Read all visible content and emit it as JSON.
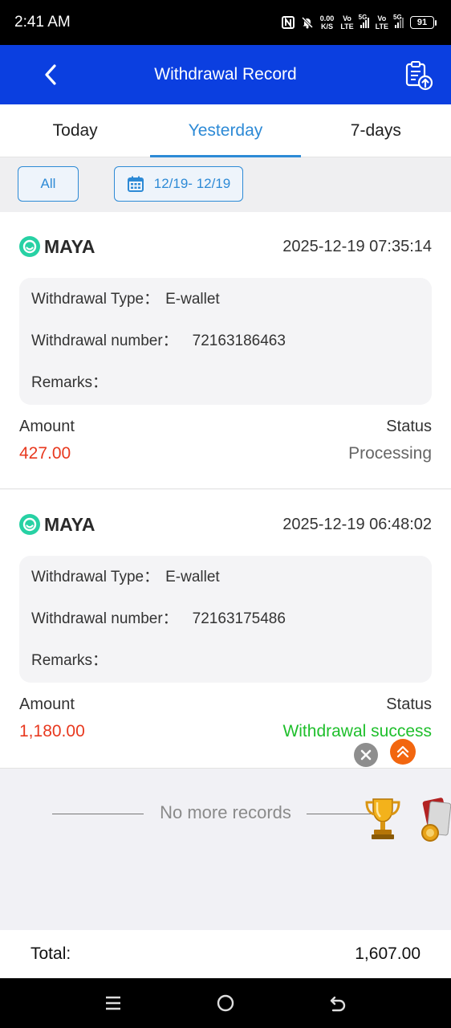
{
  "status_bar": {
    "time": "2:41 AM",
    "speed_value": "0.00",
    "speed_unit": "K/S",
    "net1_top": "Vo",
    "net1_bottom": "LTE",
    "sig1_label": "5G",
    "net2_top": "Vo",
    "net2_bottom": "LTE",
    "sig2_label": "5G",
    "battery": "91"
  },
  "header": {
    "title": "Withdrawal Record"
  },
  "tabs": [
    {
      "label": "Today",
      "active": false
    },
    {
      "label": "Yesterday",
      "active": true
    },
    {
      "label": "7-days",
      "active": false
    }
  ],
  "filters": {
    "all_label": "All",
    "date_range": "12/19- 12/19"
  },
  "records": [
    {
      "provider": "MAYA",
      "datetime": "2025-12-19 07:35:14",
      "type_label": "Withdrawal Type：",
      "type_value": "E-wallet",
      "number_label": "Withdrawal number：",
      "number_value": "72163186463",
      "remarks_label": "Remarks：",
      "remarks_value": "",
      "amount_label": "Amount",
      "amount_value": "427.00",
      "status_label": "Status",
      "status_value": "Processing"
    },
    {
      "provider": "MAYA",
      "datetime": "2025-12-19 06:48:02",
      "type_label": "Withdrawal Type：",
      "type_value": "E-wallet",
      "number_label": "Withdrawal number：",
      "number_value": "72163175486",
      "remarks_label": "Remarks：",
      "remarks_value": "",
      "amount_label": "Amount",
      "amount_value": "1,180.00",
      "status_label": "Status",
      "status_value": "Withdrawal success"
    }
  ],
  "end_text": "No more records",
  "total": {
    "label": "Total:",
    "value": "1,607.00"
  },
  "colors": {
    "header_blue": "#0b3fe0",
    "accent_blue": "#2d8ad6",
    "amount_red": "#e8391f",
    "success_green": "#1fbf2c",
    "maya_green": "#27d1a4",
    "float_orange": "#f2660f"
  },
  "icons": {
    "back": "chevron-left-icon",
    "header_action": "clipboard-upload-icon",
    "calendar": "calendar-icon",
    "close": "close-icon",
    "scroll_top": "double-chevron-up-icon",
    "trophy": "trophy-icon"
  }
}
